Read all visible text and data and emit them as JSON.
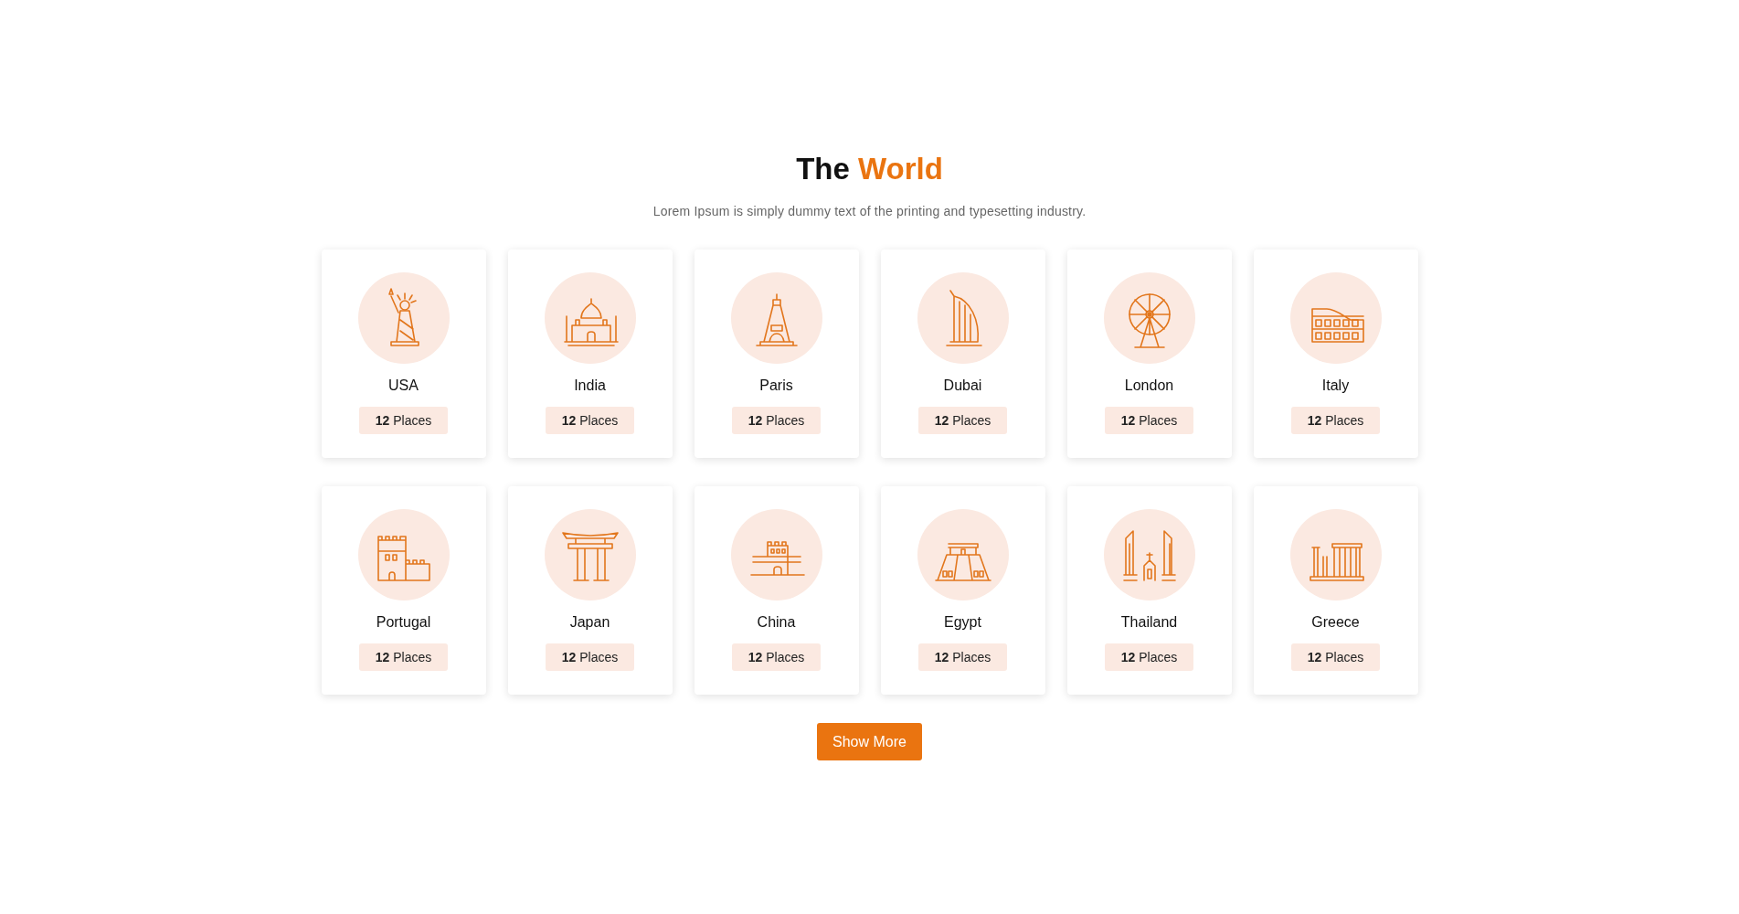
{
  "heading": {
    "lead": "The",
    "highlight": "World"
  },
  "subtitle": "Lorem Ipsum is simply dummy text of the printing and typesetting industry.",
  "destinations": [
    {
      "name": "USA",
      "places": "**12** Places"
    },
    {
      "name": "India",
      "places": "**12** Places"
    },
    {
      "name": "Paris",
      "places": "**12** Places"
    },
    {
      "name": "Dubai",
      "places": "**12** Places"
    },
    {
      "name": "London",
      "places": "**12** Places"
    },
    {
      "name": "Italy",
      "places": "**12** Places"
    },
    {
      "name": "Portugal",
      "places": "**12** Places"
    },
    {
      "name": "Japan",
      "places": "**12** Places"
    },
    {
      "name": "China",
      "places": "**12** Places"
    },
    {
      "name": "Egypt",
      "places": "**12** Places"
    },
    {
      "name": "Thailand",
      "places": "**12** Places"
    },
    {
      "name": "Greece",
      "places": "**12** Places"
    }
  ],
  "button": "Show More"
}
